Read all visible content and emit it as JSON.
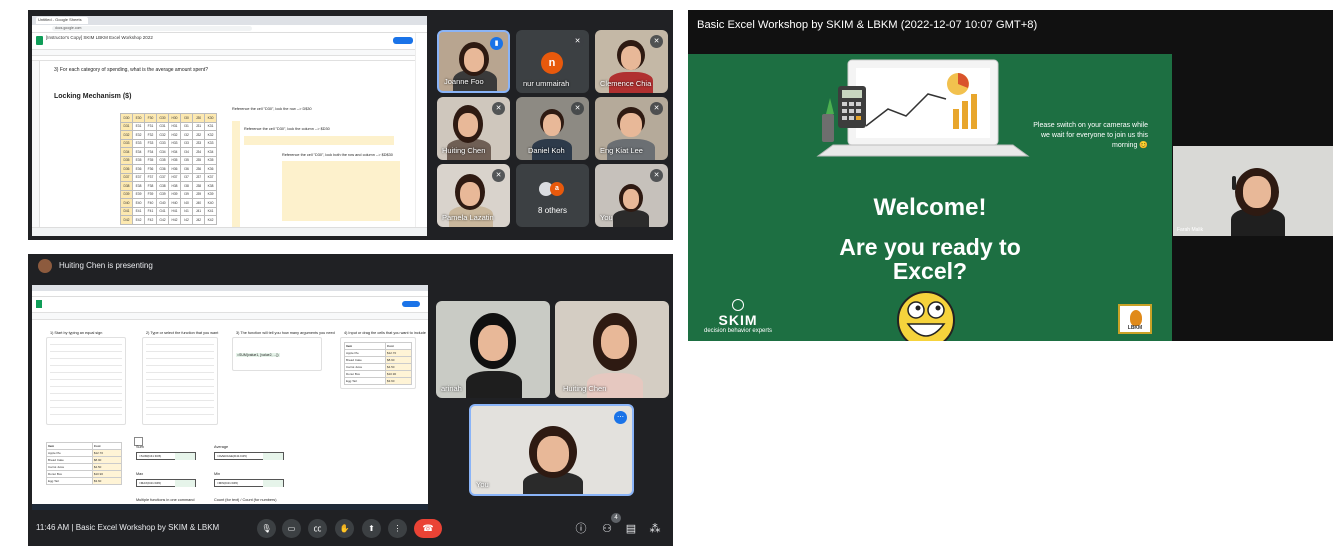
{
  "panel_a": {
    "sheet": {
      "tab_title": "Untitled - Google Sheets",
      "url": "docs.google.com",
      "doc_title": "[Instructor's Copy] SKIM LBKM Excel Workshop 2022",
      "question_text": "3) For each category of spending, what is the average amount spent?",
      "lock_title": "Locking Mechanism ($)",
      "note_1": "Reference the cell \"D30\", lock the row --> D$30",
      "note_2": "Reference the cell \"D30\", lock the column --> $D30",
      "note_3": "Reference the cell \"D30\", lock both the row and column --> $D$30",
      "grid_rows": [
        [
          "D30",
          "E30",
          "F30",
          "G30",
          "H30",
          "I30",
          "J30",
          "K30"
        ],
        [
          "D31",
          "E31",
          "F31",
          "G31",
          "H31",
          "I31",
          "J31",
          "K31"
        ],
        [
          "D32",
          "E32",
          "F32",
          "G32",
          "H32",
          "I32",
          "J32",
          "K32"
        ],
        [
          "D33",
          "E33",
          "F33",
          "G33",
          "H33",
          "I33",
          "J33",
          "K33"
        ],
        [
          "D34",
          "E34",
          "F34",
          "G34",
          "H34",
          "I34",
          "J34",
          "K34"
        ],
        [
          "D35",
          "E35",
          "F35",
          "G35",
          "H35",
          "I35",
          "J35",
          "K35"
        ],
        [
          "D36",
          "E36",
          "F36",
          "G36",
          "H36",
          "I36",
          "J36",
          "K36"
        ],
        [
          "D37",
          "E37",
          "F37",
          "G37",
          "H37",
          "I37",
          "J37",
          "K37"
        ],
        [
          "D38",
          "E38",
          "F38",
          "G38",
          "H38",
          "I38",
          "J38",
          "K38"
        ],
        [
          "D39",
          "E39",
          "F39",
          "G39",
          "H39",
          "I39",
          "J39",
          "K39"
        ],
        [
          "D40",
          "E40",
          "F40",
          "G40",
          "H40",
          "I40",
          "J40",
          "K40"
        ],
        [
          "D41",
          "E41",
          "F41",
          "G41",
          "H41",
          "I41",
          "J41",
          "K41"
        ],
        [
          "D42",
          "E42",
          "F42",
          "G42",
          "H42",
          "I42",
          "J42",
          "K42"
        ]
      ]
    },
    "participants": {
      "p1": "Joanne Foo",
      "p2": "nur ummairah",
      "p2_initial": "n",
      "p3": "Clemence Chia",
      "p4": "Huiting Chen",
      "p5": "Daniel Koh",
      "p6": "Eng Kiat Lee",
      "p7": "Pamela Lazatin",
      "others": "8 others",
      "others_initial": "a",
      "self": "You"
    }
  },
  "panel_b": {
    "presenting": "Huiting Chen is presenting",
    "sheet": {
      "col_1": "1) Start by typing an equal sign",
      "col_2": "2) Type or select the function that you want",
      "col_3": "3) The function will tell you how many arguments you need",
      "col_4": "4) Input or drag the cells that you want to include",
      "formula_hint": "=SUM(value1, [value2, ...])",
      "items_header": "Item",
      "cost_header": "Cost",
      "items": [
        [
          "Apple Pie",
          "$12.70"
        ],
        [
          "Bread Cake",
          "$8.90"
        ],
        [
          "Carrot Juice",
          "$4.50"
        ],
        [
          "Donut Box",
          "$10.90"
        ],
        [
          "Egg Tart",
          "$3.60"
        ]
      ],
      "sum_label": "Sum",
      "average_label": "Average",
      "max_label": "Max",
      "min_label": "Min",
      "sum_formula": "=SUM(D41:D45)",
      "average_formula": "=AVERAGE(D41:D45)",
      "max_formula": "=MAX(D41:D45)",
      "min_formula": "=MIN(D41:D45)",
      "multi_label": "Multiple functions in one command",
      "count_label": "Count (for text) / Count (for numbers)"
    },
    "tiles": {
      "t1": "arinah",
      "t2": "Huiting Chen",
      "self": "You"
    },
    "controls": {
      "time_meeting": "11:46 AM  |  Basic Excel Workshop by SKIM & LBKM",
      "people_count": "4"
    }
  },
  "panel_c": {
    "title": "Basic Excel Workshop by SKIM & LBKM (2022-12-07 10:07 GMT+8)",
    "slide": {
      "note": "Please switch on your cameras while we wait for everyone to join us this morning 😊",
      "welcome": "Welcome!",
      "ready_1": "Are you ready to",
      "ready_2": "Excel?",
      "skim": "SKIM",
      "skim_tag": "decision behavior experts",
      "lbkm": "LBKM"
    },
    "presenter_tile": "Farah Malik"
  },
  "colors": {
    "meet_bg": "#202124",
    "slide_green": "#1d6f42",
    "end_call_red": "#ea4335",
    "avatar_orange": "#e8590c",
    "active_blue": "#8ab4f8"
  },
  "icons": [
    "mic-off-icon",
    "audio-active-icon",
    "mic-icon",
    "camera-icon",
    "captions-icon",
    "raise-hand-icon",
    "present-icon",
    "more-icon",
    "end-call-icon",
    "info-icon",
    "people-icon",
    "chat-icon",
    "activities-icon"
  ]
}
